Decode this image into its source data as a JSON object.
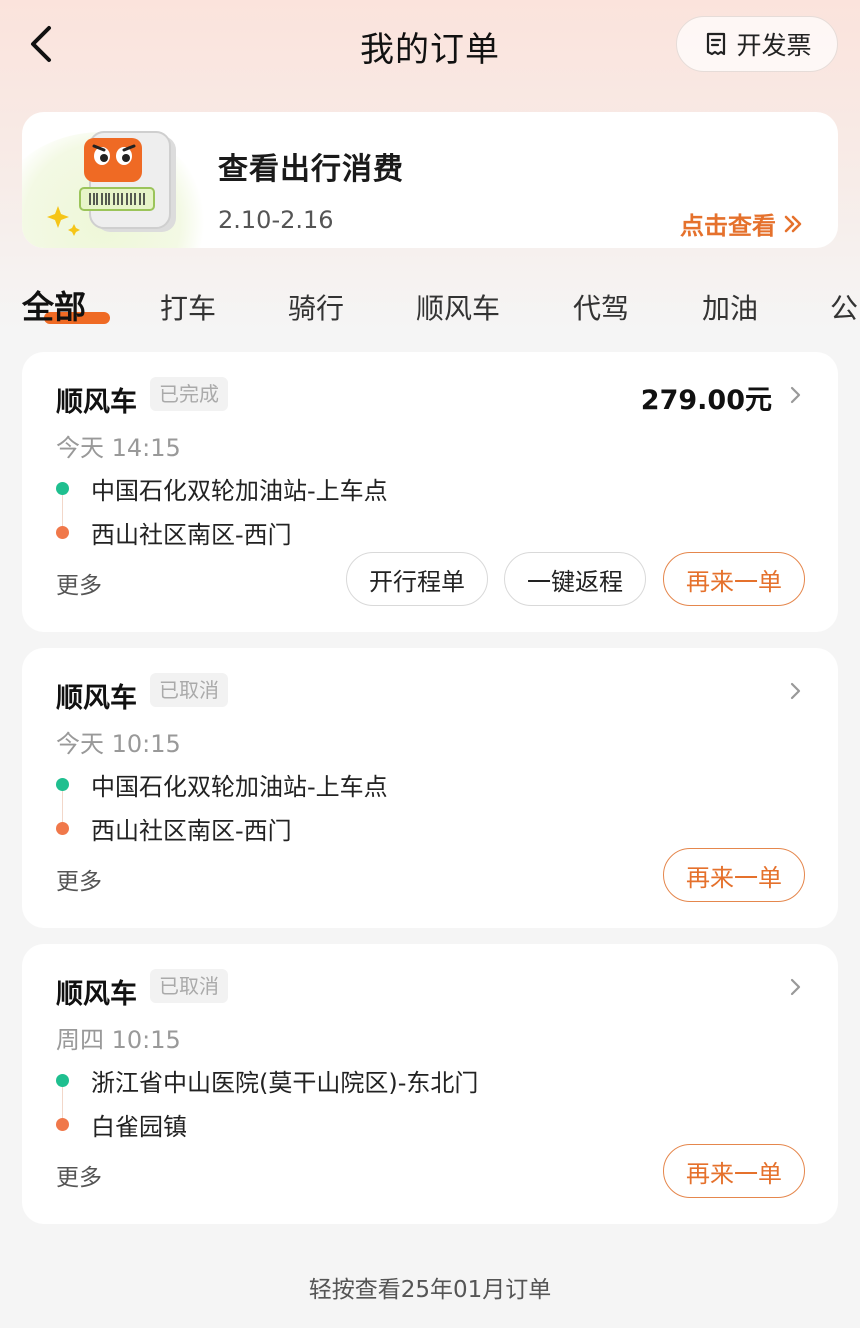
{
  "header": {
    "title": "我的订单",
    "back_icon": "chevron-left-icon",
    "invoice_label": "开发票",
    "invoice_icon": "receipt-icon"
  },
  "banner": {
    "title": "查看出行消费",
    "date_range": "2.10-2.16",
    "link_label": "点击查看",
    "link_icon": "double-chevron-right-icon",
    "accent_color": "#e5712c"
  },
  "tabs": [
    {
      "label": "全部",
      "active": true
    },
    {
      "label": "打车"
    },
    {
      "label": "骑行"
    },
    {
      "label": "顺风车"
    },
    {
      "label": "代驾"
    },
    {
      "label": "加油"
    },
    {
      "label": "公"
    }
  ],
  "orders": [
    {
      "type": "顺风车",
      "status": "已完成",
      "price": "279.00元",
      "time": "今天 14:15",
      "start": "中国石化双轮加油站-上车点",
      "end": "西山社区南区-西门",
      "more": "更多",
      "actions": [
        "开行程单",
        "一键返程",
        "再来一单"
      ]
    },
    {
      "type": "顺风车",
      "status": "已取消",
      "price": "",
      "time": "今天 10:15",
      "start": "中国石化双轮加油站-上车点",
      "end": "西山社区南区-西门",
      "more": "更多",
      "actions": [
        "再来一单"
      ]
    },
    {
      "type": "顺风车",
      "status": "已取消",
      "price": "",
      "time": "周四 10:15",
      "start": "浙江省中山医院(莫干山院区)-东北门",
      "end": "白雀园镇",
      "more": "更多",
      "actions": [
        "再来一单"
      ]
    }
  ],
  "footer": {
    "link_label": "轻按查看25年01月订单"
  },
  "colors": {
    "accent": "#ef6a24",
    "start_dot": "#1fbf8f",
    "end_dot": "#f0784a"
  }
}
